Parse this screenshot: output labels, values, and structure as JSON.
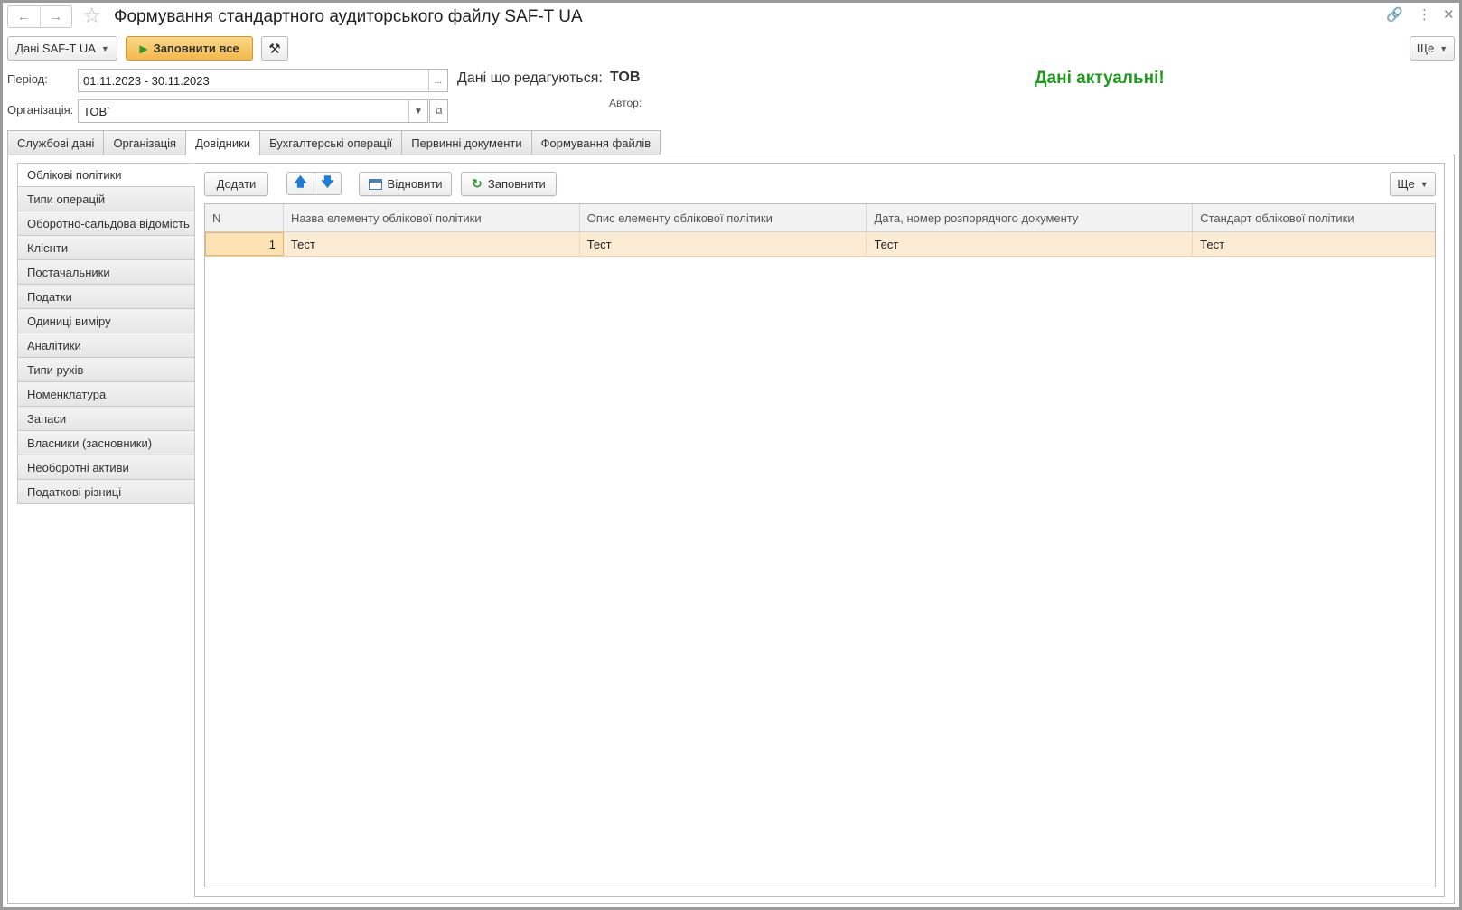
{
  "window": {
    "title": "Формування стандартного аудиторського файлу SAF-T UA",
    "controls": [
      "link-icon",
      "more-vertical-icon",
      "close-icon"
    ]
  },
  "toolbar": {
    "data_menu_label": "Дані SAF-T UA",
    "fill_all_label": "Заповнити все",
    "settings_icon": "tools-icon",
    "more_label": "Ще"
  },
  "form": {
    "period_label": "Період:",
    "period_value": "01.11.2023 - 30.11.2023",
    "period_button": "...",
    "org_label": "Організація:",
    "org_value": "ТОВ`",
    "editing_label": "Дані що редагуються:",
    "editing_value": "ТОВ",
    "author_label": "Автор:",
    "status_text": "Дані актуальні!",
    "status_color": "#1f9a1f"
  },
  "tabs": [
    {
      "label": "Службові дані"
    },
    {
      "label": "Організація"
    },
    {
      "label": "Довідники"
    },
    {
      "label": "Бухгалтерські операції"
    },
    {
      "label": "Первинні документи"
    },
    {
      "label": "Формування файлів"
    }
  ],
  "active_tab": "Довідники",
  "side_items": [
    {
      "label": "Облікові політики"
    },
    {
      "label": "Типи операцій"
    },
    {
      "label": "Оборотно-сальдова відомість"
    },
    {
      "label": "Клієнти"
    },
    {
      "label": "Постачальники"
    },
    {
      "label": "Податки"
    },
    {
      "label": "Одиниці виміру"
    },
    {
      "label": "Аналітики"
    },
    {
      "label": "Типи рухів"
    },
    {
      "label": "Номенклатура"
    },
    {
      "label": "Запаси"
    },
    {
      "label": "Власники (засновники)"
    },
    {
      "label": "Необоротні активи"
    },
    {
      "label": "Податкові різниці"
    }
  ],
  "panel_toolbar": {
    "add_label": "Додати",
    "restore_label": "Відновити",
    "fill_label": "Заповнити",
    "more_label": "Ще"
  },
  "table": {
    "columns": [
      "N",
      "Назва елементу облікової політики",
      "Опис елементу облікової політики",
      "Дата, номер розпорядчого документу",
      "Стандарт облікової політики"
    ],
    "rows": [
      [
        "1",
        "Тест",
        "Тест",
        "Тест",
        "Тест"
      ]
    ]
  }
}
